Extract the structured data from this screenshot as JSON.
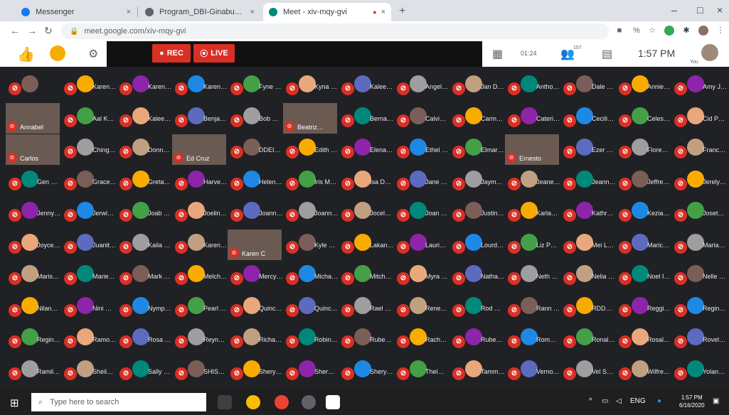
{
  "browser": {
    "tabs": [
      {
        "title": "Messenger",
        "active": false,
        "favicon_color": "#1877f2"
      },
      {
        "title": "Program_DBI-Ginabuhy to Hin…",
        "active": false,
        "favicon_color": "#5f6368"
      },
      {
        "title": "Meet - xiv-mqy-gvi",
        "active": true,
        "favicon_color": "#00897b"
      }
    ],
    "new_tab": "+",
    "url": "meet.google.com/xiv-mqy-gvi",
    "window_controls": {
      "minimize": "–",
      "maximize": "□",
      "close": "×"
    }
  },
  "meet": {
    "rec_label": "REC",
    "live_label": "LIVE",
    "timer": "01:24",
    "participants_count": "157",
    "clock": "1:57 PM",
    "you_label": "You"
  },
  "grid": {
    "rows": [
      [
        "",
        "Karen d…",
        "Karen K…",
        "Karen P…",
        "Fyne Sa…",
        "Kyna Ta…",
        "Kaleen…",
        "Angelo…",
        "Jan Du…",
        "Anthony…",
        "Dale Pa…",
        "Annie to…",
        "Amy J…"
      ],
      [
        "Annabel",
        "Aal Kas…",
        "Kaleem…",
        "Benjami…",
        "Bob DA…",
        "Beatriz…",
        "Bernadi…",
        "Calvin r…",
        "Carmela…",
        "Caterinit…",
        "Cecilia…",
        "Celestia…",
        "Cid Perez"
      ],
      [
        "Carlos",
        "Ching ao…",
        "Donna S…",
        "Ed Cruz",
        "DDEIS…",
        "Edith Ga…",
        "Elena M…",
        "Ethel Phi…",
        "Elmar T…",
        "Ernesto",
        "Ezer Lnl…",
        "Florence…",
        "Francis…"
      ],
      [
        "Gen Bri…",
        "Grace M…",
        "Greta Ga…",
        "Harvey l…",
        "Helene…",
        "Iris Men…",
        "Isa Dam…",
        "Jane M…",
        "Jaymar…",
        "Jeaneth…",
        "Jeanne…",
        "Jeffrey…",
        "Jerelyn…"
      ],
      [
        "Jenny Z…",
        "Jerwin…",
        "Joab D…",
        "Joeline…",
        "Joanna ra…",
        "Joanne…",
        "Jocelyn…",
        "Joan mi…",
        "Justin Pa…",
        "Karlan…",
        "Kathryn l…",
        "Keziah…",
        "Joseta R…"
      ],
      [
        "Joyce A…",
        "Juanita…",
        "Kaila C…",
        "Karen P…",
        "Karen C",
        "Kyle Ma…",
        "Lakan…",
        "Laurie F…",
        "Lourdes…",
        "Liz Pat…",
        "Mei Luz…",
        "Marichel…",
        "Maria C…"
      ],
      [
        "Marisol…",
        "Marie E…",
        "Mark An…",
        "Melchor…",
        "Mercy P…",
        "Michael…",
        "Mitchel…",
        "Myra Ha…",
        "Nathan…",
        "Neth Ro…",
        "Nelia Cr…",
        "Noel Isip",
        "Nelle M…"
      ],
      [
        "Nilan…",
        "Nini Ma…",
        "Nymphai…",
        "Pearl An…",
        "Quincy…",
        "Quinci…",
        "Rael Loo…",
        "Renee C…",
        "Rod Du…",
        "Rann D…",
        "RDDD R…",
        "Reggie…",
        "Regina…"
      ],
      [
        "Regine…",
        "Ramon…",
        "Rosa F…",
        "Reynald…",
        "Richard…",
        "Robin Di…",
        "Rubens…",
        "Rachel S…",
        "Ruben R…",
        "Rommel…",
        "Ronaldo…",
        "Rosalie…",
        "Rovelie J…"
      ],
      [
        "Ramilyn…",
        "Sheila T…",
        "Sally Ga…",
        "SHISEL…",
        "Sheryl…",
        "Sherwin…",
        "Sheryll…",
        "Thelma…",
        "Tammy…",
        "Vernon…",
        "Vel Sant…",
        "Wilfredo…",
        "Yolanna…"
      ]
    ],
    "avatar_colors": [
      "#7b5e57",
      "#f9ab00",
      "#8e24aa",
      "#1e88e5",
      "#43a047",
      "#e8a87c",
      "#5c6bc0",
      "#9e9e9e",
      "#c0a080",
      "#00897b"
    ],
    "video_names": [
      "Annabel",
      "Carlos",
      "Ed Cruz",
      "Beatriz…",
      "Ernesto",
      "Karen C"
    ]
  },
  "taskbar": {
    "search_placeholder": "Type here to search",
    "tray_lang": "ENG",
    "time": "1:57 PM",
    "date": "6/16/2020"
  }
}
